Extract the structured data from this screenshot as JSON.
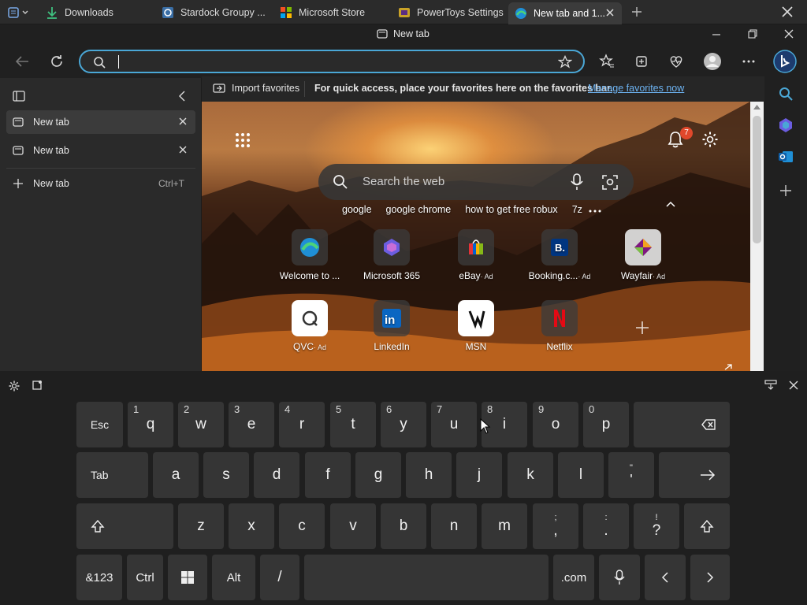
{
  "groupy_tabs": [
    {
      "label": "Downloads",
      "icon": "download-icon"
    },
    {
      "label": "Stardock Groupy ...",
      "icon": "groupy-icon"
    },
    {
      "label": "Microsoft Store",
      "icon": "store-icon"
    },
    {
      "label": "PowerToys Settings",
      "icon": "powertoys-icon"
    },
    {
      "label": "New tab and 1...",
      "icon": "edge-icon"
    }
  ],
  "window": {
    "title": "New tab"
  },
  "address": {
    "value": "",
    "placeholder": ""
  },
  "favbar": {
    "import_label": "Import favorites",
    "message": "For quick access, place your favorites here on the favorites bar.",
    "manage_link": "Manage favorites now"
  },
  "vertical_tabs": {
    "tabs": [
      {
        "label": "New tab"
      },
      {
        "label": "New tab"
      }
    ],
    "new_tab_label": "New tab",
    "new_tab_shortcut": "Ctrl+T"
  },
  "ntp": {
    "search_placeholder": "Search the web",
    "notifications_count": "7",
    "suggestions": [
      "google",
      "google chrome",
      "how to get free robux",
      "7z"
    ],
    "tiles_row1": [
      {
        "label": "Welcome to ...",
        "ad": ""
      },
      {
        "label": "Microsoft 365",
        "ad": ""
      },
      {
        "label": "eBay",
        "ad": "· Ad"
      },
      {
        "label": "Booking.c...",
        "ad": "· Ad"
      },
      {
        "label": "Wayfair",
        "ad": "· Ad"
      }
    ],
    "tiles_row2": [
      {
        "label": "QVC",
        "ad": "· Ad"
      },
      {
        "label": "LinkedIn",
        "ad": ""
      },
      {
        "label": "MSN",
        "ad": ""
      },
      {
        "label": "Netflix",
        "ad": ""
      }
    ]
  },
  "keyboard": {
    "row1": [
      "Esc",
      "q",
      "w",
      "e",
      "r",
      "t",
      "y",
      "u",
      "i",
      "o",
      "p"
    ],
    "row1_nums": [
      "1",
      "2",
      "3",
      "4",
      "5",
      "6",
      "7",
      "8",
      "9",
      "0"
    ],
    "row2": [
      "Tab",
      "a",
      "s",
      "d",
      "f",
      "g",
      "h",
      "j",
      "k",
      "l"
    ],
    "row2_quote_top": "\"",
    "row2_quote_bottom": "'",
    "row3": [
      "z",
      "x",
      "c",
      "v",
      "b",
      "n",
      "m"
    ],
    "row3_semicolon_top": ";",
    "row3_semicolon_bottom": ",",
    "row3_colon_top": ":",
    "row3_colon_bottom": ".",
    "row3_excl_top": "!",
    "row3_excl_bottom": "?",
    "row4": {
      "sym": "&123",
      "ctrl": "Ctrl",
      "alt": "Alt",
      "slash": "/",
      "com": ".com"
    }
  }
}
